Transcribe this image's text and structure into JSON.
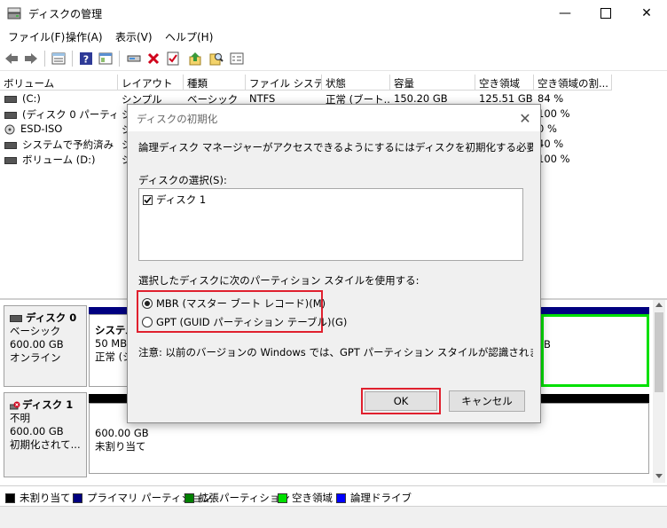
{
  "window": {
    "title": "ディスクの管理"
  },
  "menu": [
    "ファイル(F)",
    "操作(A)",
    "表示(V)",
    "ヘルプ(H)"
  ],
  "toolbar_icons": [
    "back-icon",
    "forward-icon",
    "volume-list-icon",
    "help-icon",
    "properties-icon",
    "connect-icon",
    "delete-icon",
    "check-icon",
    "up-icon",
    "search-icon",
    "window-icon"
  ],
  "volume_table": {
    "columns": [
      "ボリューム",
      "レイアウト",
      "種類",
      "ファイル システム",
      "状態",
      "容量",
      "空き領域",
      "空き領域の割..."
    ],
    "rows": [
      [
        "(C:)",
        "シンプル",
        "ベーシック",
        "NTFS",
        "正常 (ブート...",
        "150.20 GB",
        "125.51 GB",
        "84 %"
      ],
      [
        "(ディスク 0 パーティシ...",
        "シ",
        "",
        "",
        "",
        "",
        "",
        "100 %"
      ],
      [
        "ESD-ISO",
        "シ",
        "",
        "",
        "",
        "",
        "",
        "0 %"
      ],
      [
        "システムで予約済み",
        "シ",
        "",
        "",
        "",
        "",
        "",
        "40 %"
      ],
      [
        "ボリューム (D:)",
        "シ",
        "",
        "",
        "",
        "",
        "",
        "100 %"
      ]
    ]
  },
  "disks": [
    {
      "name": "ディスク 0",
      "type": "ベーシック",
      "size": "600.00 GB",
      "status": "オンライン",
      "partition_name": "システム",
      "partition_size": "50 MB",
      "partition_status": "正常 (シ",
      "right_fragment": "B"
    },
    {
      "name": "ディスク 1",
      "type": "不明",
      "size": "600.00 GB",
      "status": "初期化されて...",
      "partition_size": "600.00 GB",
      "partition_status": "未割り当て"
    }
  ],
  "legend": [
    {
      "label": "未割り当て",
      "color": "#000000"
    },
    {
      "label": "プライマリ パーティション",
      "color": "#000080"
    },
    {
      "label": "拡張パーティション",
      "color": "#008000"
    },
    {
      "label": "空き領域",
      "color": "#00e000"
    },
    {
      "label": "論理ドライブ",
      "color": "#0000ff"
    }
  ],
  "dialog": {
    "title": "ディスクの初期化",
    "description": "論理ディスク マネージャーがアクセスできるようにするにはディスクを初期化する必要があります。",
    "select_label": "ディスクの選択(S):",
    "disk_item": "ディスク 1",
    "disk_checked": true,
    "style_label": "選択したディスクに次のパーティション スタイルを使用する:",
    "options": [
      "MBR (マスター ブート レコード)(M)",
      "GPT (GUID パーティション テーブル)(G)"
    ],
    "selected_option": 0,
    "note": "注意: 以前のバージョンの Windows では、GPT パーティション スタイルが認識されません。",
    "ok_label": "OK",
    "cancel_label": "キャンセル"
  }
}
